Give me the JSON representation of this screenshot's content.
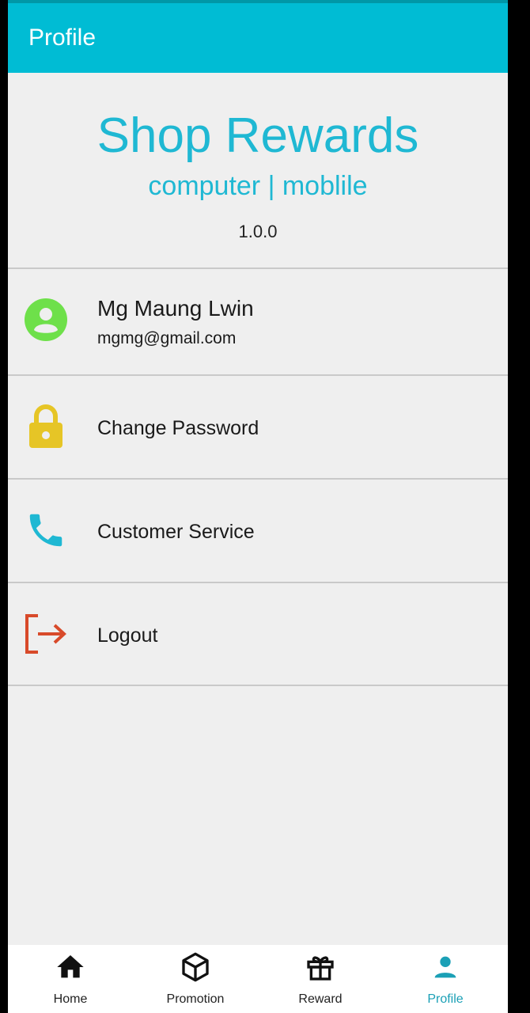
{
  "appbar": {
    "title": "Profile"
  },
  "brand": {
    "title": "Shop Rewards",
    "subtitle": "computer | moblile",
    "version": "1.0.0"
  },
  "user": {
    "name": "Mg Maung Lwin",
    "email": "mgmg@gmail.com",
    "icon": "account-circle-icon"
  },
  "menu": [
    {
      "label": "Change Password",
      "icon": "lock-icon"
    },
    {
      "label": "Customer Service",
      "icon": "phone-icon"
    },
    {
      "label": "Logout",
      "icon": "logout-icon"
    }
  ],
  "bottom_nav": [
    {
      "label": "Home",
      "icon": "home-icon",
      "active": false
    },
    {
      "label": "Promotion",
      "icon": "package-icon",
      "active": false
    },
    {
      "label": "Reward",
      "icon": "gift-icon",
      "active": false
    },
    {
      "label": "Profile",
      "icon": "person-icon",
      "active": true
    }
  ],
  "colors": {
    "primary": "#00bcd4",
    "brand_text": "#1fb8d3",
    "avatar": "#6ee04a",
    "lock": "#e6c526",
    "phone": "#1fb8d3",
    "logout": "#d84a2a",
    "active_nav": "#1ba0b6"
  }
}
